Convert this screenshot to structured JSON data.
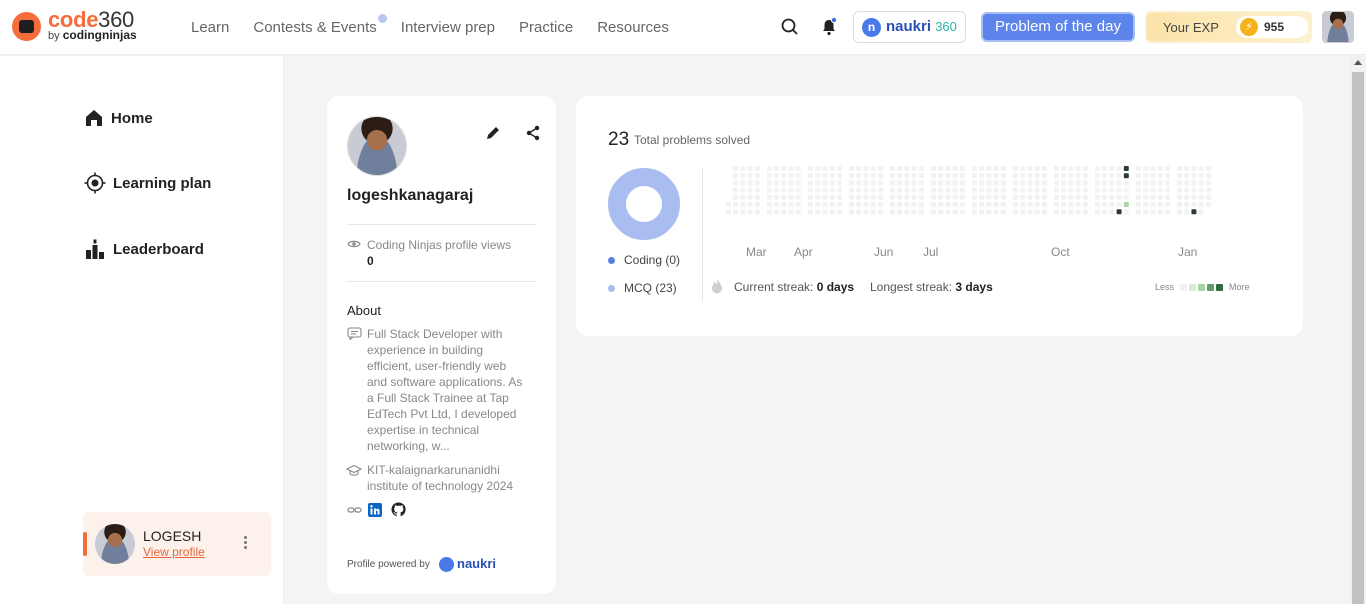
{
  "brand": {
    "name": "code",
    "number": "360",
    "by": "by",
    "sub": "codingninjas"
  },
  "nav": [
    "Learn",
    "Contests & Events",
    "Interview prep",
    "Practice",
    "Resources"
  ],
  "naukri": {
    "letter": "n",
    "name": "naukri",
    "num": "360"
  },
  "potd_label": "Problem of the day",
  "exp": {
    "label": "Your EXP",
    "value": "955"
  },
  "sidebar": {
    "items": [
      {
        "label": "Home"
      },
      {
        "label": "Learning plan"
      },
      {
        "label": "Leaderboard"
      }
    ],
    "user": {
      "name": "LOGESH",
      "link": "View profile"
    }
  },
  "profile": {
    "username": "logeshkanagaraj",
    "views_label": "Coding Ninjas profile views",
    "views": "0",
    "about_title": "About",
    "about_lines": [
      "Full Stack Developer with",
      "experience in building",
      "efficient, user-friendly web",
      "and software applications. As",
      "a Full Stack Trainee at Tap",
      "EdTech Pvt Ltd, I developed",
      "expertise in technical",
      "networking, w..."
    ],
    "edu_lines": [
      "KIT-kalaignarkarunanidhi",
      "institute of technology 2024"
    ],
    "powered_label": "Profile powered by",
    "powered_brand": "naukri"
  },
  "stats": {
    "total": "23",
    "total_label": "Total problems solved",
    "legend": [
      {
        "label": "Coding (0)",
        "color": "#5a7fe0"
      },
      {
        "label": "MCQ (23)",
        "color": "#a9bdf0"
      }
    ],
    "months": [
      "Mar",
      "Apr",
      "Jun",
      "Jul",
      "Oct",
      "Jan"
    ],
    "current_streak_label": "Current streak:",
    "current_streak": "0 days",
    "longest_streak_label": "Longest streak:",
    "longest_streak": "3 days",
    "less": "Less",
    "more": "More",
    "scale_colors": [
      "#f2f2f2",
      "#dcebd8",
      "#a9d3a2",
      "#5f9e6a",
      "#2f6b47"
    ]
  },
  "colors": {
    "accent": "#f66c3b",
    "primary": "#5c84ea"
  }
}
